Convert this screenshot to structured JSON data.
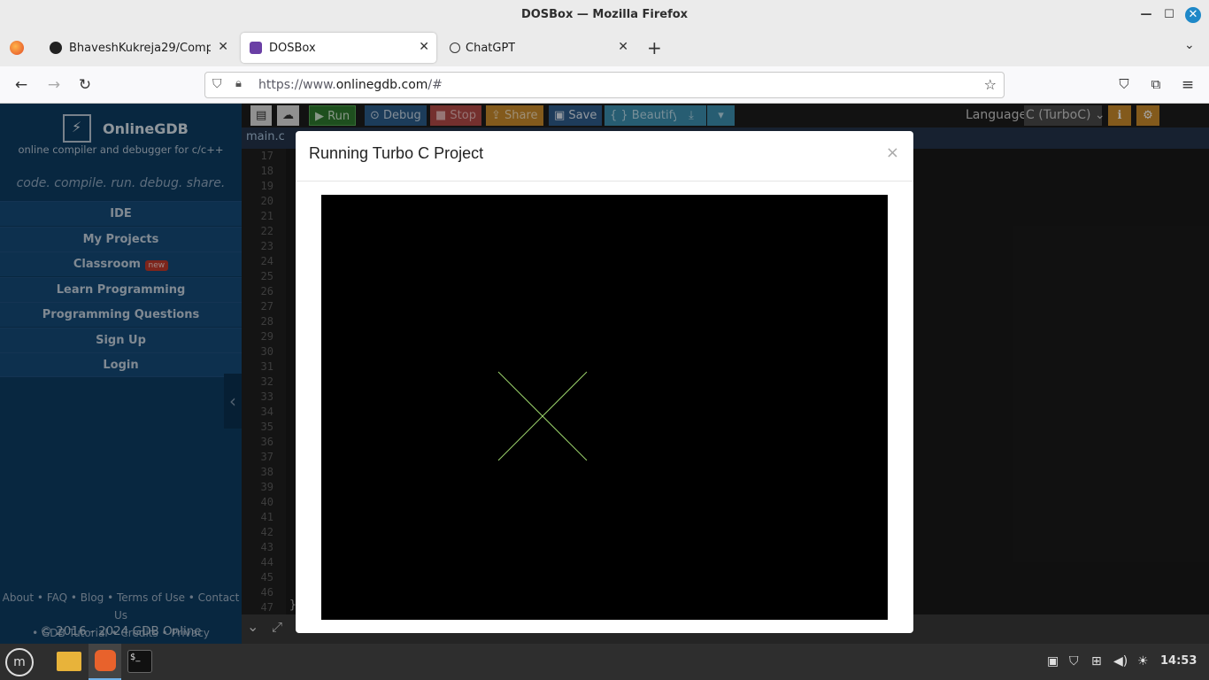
{
  "window": {
    "title": "DOSBox — Mozilla Firefox"
  },
  "tabs": [
    {
      "label": "BhaveshKukreja29/Computer",
      "active": false
    },
    {
      "label": "DOSBox",
      "active": true
    },
    {
      "label": "ChatGPT",
      "active": false
    }
  ],
  "url": {
    "prefix": "https://www.",
    "domain": "onlinegdb.com",
    "suffix": "/#"
  },
  "sidebar": {
    "brand": "OnlineGDB",
    "tagline": "online compiler and debugger for c/c++",
    "slogan": "code. compile. run. debug. share.",
    "items": [
      {
        "label": "IDE"
      },
      {
        "label": "My Projects"
      },
      {
        "label": "Classroom",
        "badge": "new"
      },
      {
        "label": "Learn Programming"
      },
      {
        "label": "Programming Questions"
      },
      {
        "label": "Sign Up"
      },
      {
        "label": "Login"
      }
    ],
    "footer_line1": "About • FAQ • Blog • Terms of Use • Contact Us",
    "footer_line2": "• GDB Tutorial • Credits • Privacy",
    "copyright": "© 2016 - 2024 GDB Online"
  },
  "toolbar": {
    "run": "Run",
    "debug": "Debug",
    "stop": "Stop",
    "share": "Share",
    "save": "Save",
    "beautify": "{ } Beautify",
    "language_label": "Language",
    "language_value": "C (TurboC)"
  },
  "editor": {
    "file_tab": "main.c",
    "line_numbers": [
      "17",
      "18",
      "19",
      "20",
      "21",
      "22",
      "23",
      "24",
      "25",
      "26",
      "27",
      "28",
      "29",
      "30",
      "31",
      "32",
      "33",
      "34",
      "35",
      "36",
      "37",
      "38",
      "39",
      "40",
      "41",
      "42",
      "43",
      "44",
      "45",
      "46",
      "47"
    ],
    "last_line_text": "}"
  },
  "modal": {
    "title": "Running Turbo C Project",
    "close": "×"
  },
  "taskbar": {
    "clock": "14:53"
  },
  "colors": {
    "accent_sidebar": "#0d3c63",
    "run_green": "#3c8a3c",
    "drawn_lines": "#9bd36b"
  }
}
